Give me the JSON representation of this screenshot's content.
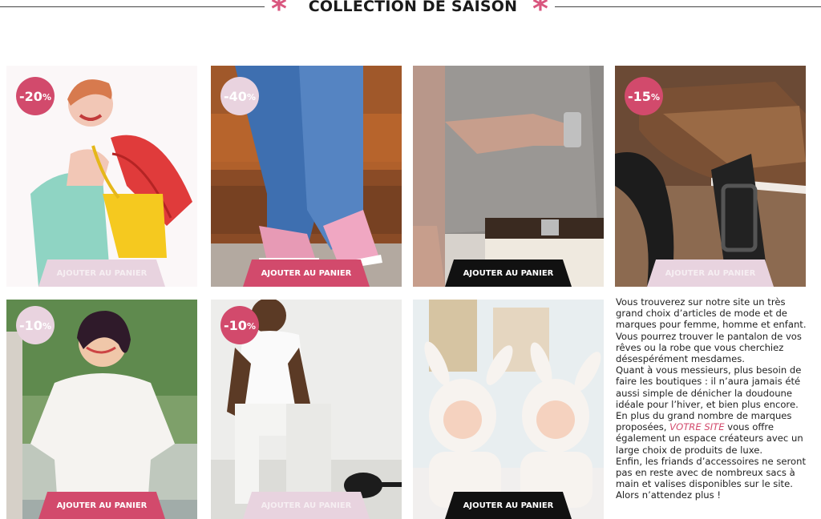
{
  "header": {
    "title": "COLLECTION DE SAISON",
    "star": "*"
  },
  "products": [
    {
      "discount": "-20",
      "pct": "%",
      "cart": "AJOUTER AU PANIER"
    },
    {
      "discount": "-40",
      "pct": "%",
      "cart": "AJOUTER AU PANIER"
    },
    {
      "cart": "AJOUTER AU PANIER"
    },
    {
      "discount": "-15",
      "pct": "%",
      "cart": "AJOUTER AU PANIER"
    },
    {
      "discount": "-10",
      "pct": "%",
      "cart": "AJOUTER AU PANIER"
    },
    {
      "discount": "-10",
      "pct": "%",
      "cart": "AJOUTER AU PANIER"
    },
    {
      "cart": "AJOUTER AU PANIER"
    }
  ],
  "description": {
    "lines": [
      "Vous trouverez sur notre site un très",
      "grand choix d’articles de mode et de",
      "marques pour femme, homme et enfant.",
      "Vous pourrez trouver le pantalon de vos",
      "rêves ou la robe que vous cherchiez",
      "désespérément mesdames.",
      "Quant à vous messieurs, plus besoin de",
      "faire les boutiques : il n’aura jamais été",
      "aussi simple de dénicher la doudoune",
      "idéale pour l’hiver, et bien plus encore.",
      "En plus du grand nombre de marques"
    ],
    "brand_prefix": "proposées, ",
    "brand": "VOTRE SITE",
    "brand_suffix": " vous offre",
    "lines_after": [
      "également un espace créateurs avec un",
      "large choix de produits de luxe.",
      "Enfin, les friands d’accessoires ne seront",
      "pas en reste avec de nombreux sacs à",
      "main et valises disponibles sur le site.",
      "Alors n’attendez plus !"
    ]
  },
  "colors": {
    "accent": "#d24a6c",
    "accent_light": "#e9d3df",
    "dark": "#111111"
  }
}
